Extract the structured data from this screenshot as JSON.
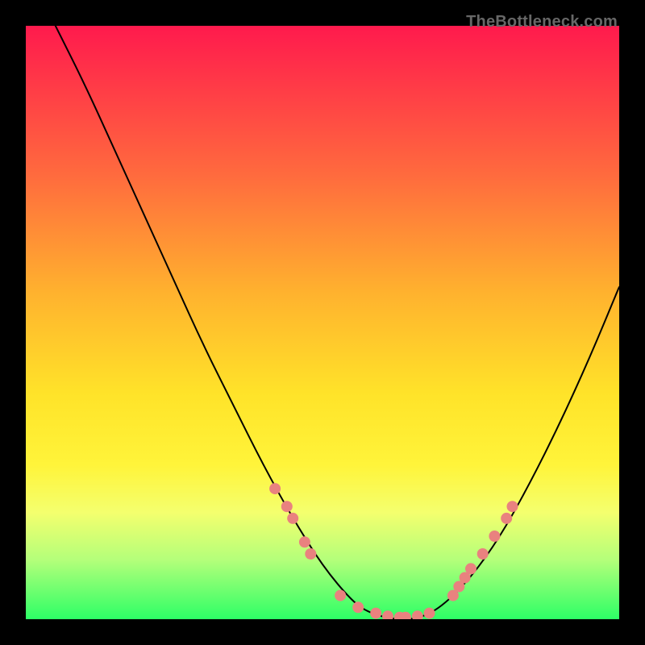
{
  "watermark": "TheBottleneck.com",
  "gradient_colors": {
    "top": "#ff1a4d",
    "mid_upper": "#ffb22e",
    "mid_lower": "#fff43a",
    "bottom": "#2dff66"
  },
  "curve_stroke": "#000000",
  "marker_color": "#e9827f",
  "chart_data": {
    "type": "line",
    "title": "",
    "xlabel": "",
    "ylabel": "",
    "xlim": [
      0,
      100
    ],
    "ylim": [
      0,
      100
    ],
    "series": [
      {
        "name": "bottleneck-curve",
        "x": [
          5,
          10,
          15,
          20,
          25,
          30,
          35,
          40,
          45,
          50,
          55,
          58,
          62,
          66,
          70,
          75,
          80,
          85,
          90,
          95,
          100
        ],
        "y": [
          100,
          90,
          79,
          68,
          57,
          46,
          36,
          26,
          17,
          9,
          3,
          1,
          0,
          0,
          2,
          7,
          14,
          23,
          33,
          44,
          56
        ]
      }
    ],
    "markers": [
      {
        "x": 42,
        "y": 22
      },
      {
        "x": 44,
        "y": 19
      },
      {
        "x": 45,
        "y": 17
      },
      {
        "x": 47,
        "y": 13
      },
      {
        "x": 48,
        "y": 11
      },
      {
        "x": 53,
        "y": 4
      },
      {
        "x": 56,
        "y": 2
      },
      {
        "x": 59,
        "y": 1
      },
      {
        "x": 61,
        "y": 0.5
      },
      {
        "x": 63,
        "y": 0.3
      },
      {
        "x": 64,
        "y": 0.3
      },
      {
        "x": 66,
        "y": 0.5
      },
      {
        "x": 68,
        "y": 1
      },
      {
        "x": 72,
        "y": 4
      },
      {
        "x": 73,
        "y": 5.5
      },
      {
        "x": 74,
        "y": 7
      },
      {
        "x": 75,
        "y": 8.5
      },
      {
        "x": 77,
        "y": 11
      },
      {
        "x": 79,
        "y": 14
      },
      {
        "x": 81,
        "y": 17
      },
      {
        "x": 82,
        "y": 19
      }
    ]
  }
}
